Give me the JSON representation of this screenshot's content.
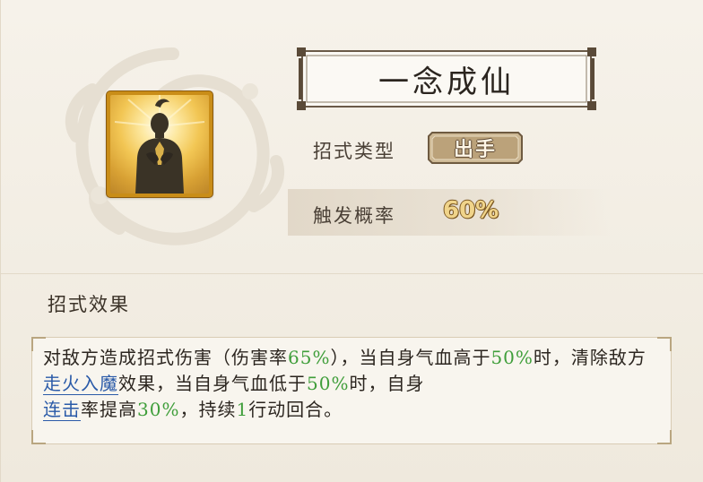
{
  "skill": {
    "name": "一念成仙",
    "type_label": "招式类型",
    "type_value": "出手",
    "rate_label": "触发概率",
    "rate_value": "60%",
    "effect_section_title": "招式效果"
  },
  "description": {
    "p1": "对敌方造成招式伤害（伤害率",
    "v1": "65%",
    "p2": "），当自身气血高于",
    "v2": "50%",
    "p3": "时，清除敌方",
    "link1": "走火入魔",
    "p4": "效果，当自身气血低于",
    "v3": "50%",
    "p5": "时，自身",
    "link2": "连击",
    "p6": "率提高",
    "v4": "30%",
    "p7": "，持续",
    "v5": "1",
    "p8": "行动回合。"
  },
  "colors": {
    "highlight_green": "#3f9e3a",
    "link_blue": "#2a5aa8",
    "icon_gold": "#c98d18"
  },
  "icons": {
    "skill_icon": "meditating-figure-icon",
    "background": "cloud-swirl-icon"
  }
}
